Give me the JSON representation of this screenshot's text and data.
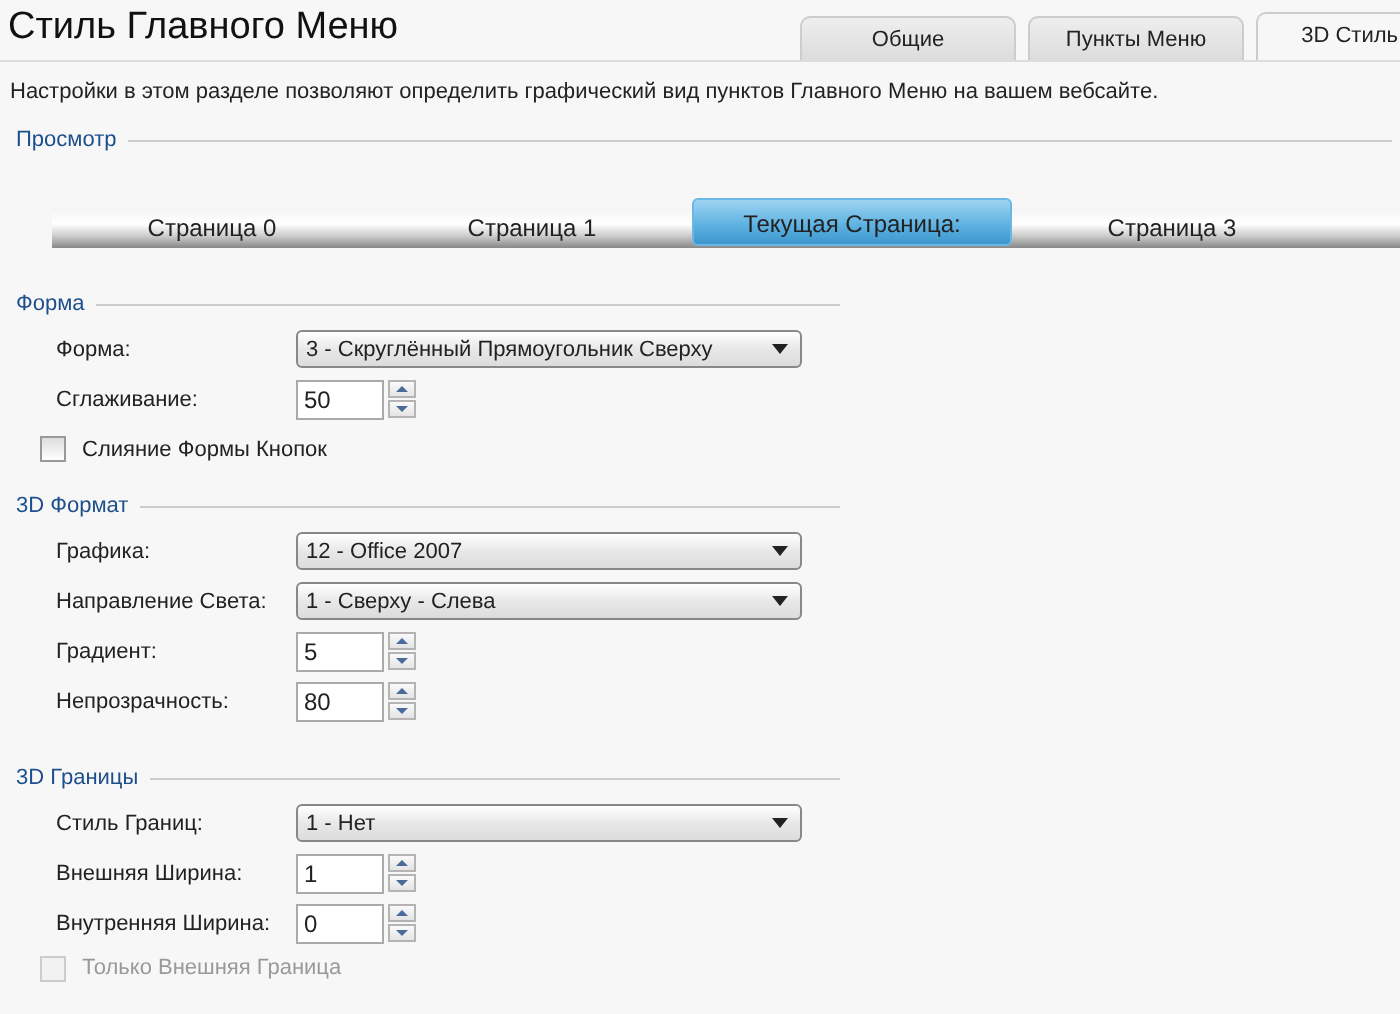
{
  "title": "Стиль Главного Меню",
  "tabs": [
    {
      "label": "Общие",
      "selected": false
    },
    {
      "label": "Пункты Меню",
      "selected": false
    },
    {
      "label": "3D Стиль",
      "selected": true
    }
  ],
  "description": "Настройки в этом разделе позволяют определить графический вид пунктов Главного Меню на вашем вебсайте.",
  "preview": {
    "heading": "Просмотр",
    "items": [
      {
        "label": "Страница  0",
        "selected": false
      },
      {
        "label": "Страница  1",
        "selected": false
      },
      {
        "label": "Текущая Страница:",
        "selected": true
      },
      {
        "label": "Страница  3",
        "selected": false
      }
    ]
  },
  "sections": [
    {
      "heading": "Форма",
      "fields": [
        {
          "kind": "dropdown",
          "label": "Форма:",
          "value": "3 - Скруглённый Прямоугольник Сверху"
        },
        {
          "kind": "spinner",
          "label": "Сглаживание:",
          "value": "50"
        },
        {
          "kind": "checkbox",
          "label": "Слияние Формы Кнопок",
          "checked": false,
          "disabled": false
        }
      ]
    },
    {
      "heading": "3D Формат",
      "fields": [
        {
          "kind": "dropdown",
          "label": "Графика:",
          "value": "12 - Office 2007"
        },
        {
          "kind": "dropdown",
          "label": "Направление Света:",
          "value": "1 - Сверху - Слева"
        },
        {
          "kind": "spinner",
          "label": "Градиент:",
          "value": "5"
        },
        {
          "kind": "spinner",
          "label": "Непрозрачность:",
          "value": "80"
        }
      ]
    },
    {
      "heading": "3D Границы",
      "fields": [
        {
          "kind": "dropdown",
          "label": "Стиль Границ:",
          "value": "1 - Нет"
        },
        {
          "kind": "spinner",
          "label": "Внешняя Ширина:",
          "value": "1"
        },
        {
          "kind": "spinner",
          "label": "Внутренняя Ширина:",
          "value": "0"
        },
        {
          "kind": "checkbox",
          "label": "Только Внешняя Граница",
          "checked": false,
          "disabled": true
        }
      ]
    }
  ]
}
